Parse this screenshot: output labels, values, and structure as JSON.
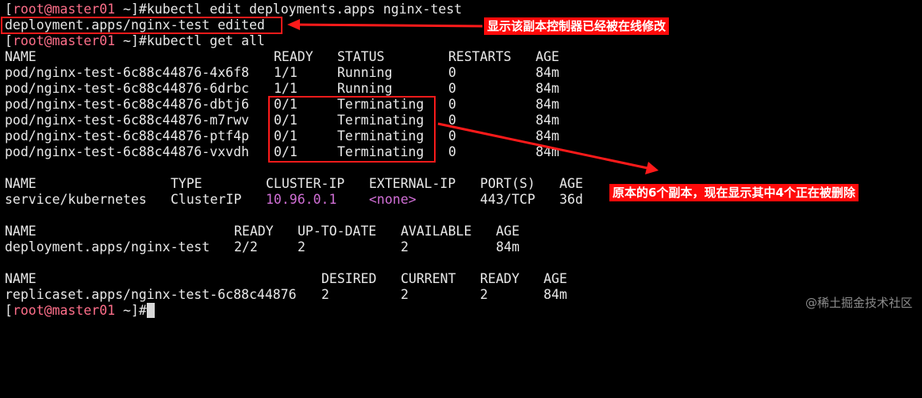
{
  "terminal": {
    "prompt_user": "root@master01",
    "prompt_dir": "~",
    "cmd_edit": "kubectl edit deployments.apps nginx-test",
    "edit_result": "deployment.apps/nginx-test edited",
    "cmd_get": "kubectl get all"
  },
  "pods": {
    "headers": [
      "NAME",
      "READY",
      "STATUS",
      "RESTARTS",
      "AGE"
    ],
    "rows": [
      [
        "pod/nginx-test-6c88c44876-4x6f8",
        "1/1",
        "Running",
        "0",
        "84m"
      ],
      [
        "pod/nginx-test-6c88c44876-6drbc",
        "1/1",
        "Running",
        "0",
        "84m"
      ],
      [
        "pod/nginx-test-6c88c44876-dbtj6",
        "0/1",
        "Terminating",
        "0",
        "84m"
      ],
      [
        "pod/nginx-test-6c88c44876-m7rwv",
        "0/1",
        "Terminating",
        "0",
        "84m"
      ],
      [
        "pod/nginx-test-6c88c44876-ptf4p",
        "0/1",
        "Terminating",
        "0",
        "84m"
      ],
      [
        "pod/nginx-test-6c88c44876-vxvdh",
        "0/1",
        "Terminating",
        "0",
        "84m"
      ]
    ]
  },
  "services": {
    "headers": [
      "NAME",
      "TYPE",
      "CLUSTER-IP",
      "EXTERNAL-IP",
      "PORT(S)",
      "AGE"
    ],
    "rows": [
      [
        "service/kubernetes",
        "ClusterIP",
        "10.96.0.1",
        "<none>",
        "443/TCP",
        "36d"
      ]
    ]
  },
  "deployments": {
    "headers": [
      "NAME",
      "READY",
      "UP-TO-DATE",
      "AVAILABLE",
      "AGE"
    ],
    "rows": [
      [
        "deployment.apps/nginx-test",
        "2/2",
        "2",
        "2",
        "84m"
      ]
    ]
  },
  "replicasets": {
    "headers": [
      "NAME",
      "DESIRED",
      "CURRENT",
      "READY",
      "AGE"
    ],
    "rows": [
      [
        "replicaset.apps/nginx-test-6c88c44876",
        "2",
        "2",
        "2",
        "84m"
      ]
    ]
  },
  "annotations": {
    "edited_note": "显示该副本控制器已经被在线修改",
    "terminating_note": "原本的6个副本，现在显示其中4个正在被删除"
  },
  "watermark": "@稀土掘金技术社区",
  "colors": {
    "background": "#000000",
    "text": "#e8e8e8",
    "prompt_user": "#ff6f8a",
    "cluster_ip": "#d16fd6",
    "annotation": "#ff0a0a"
  }
}
